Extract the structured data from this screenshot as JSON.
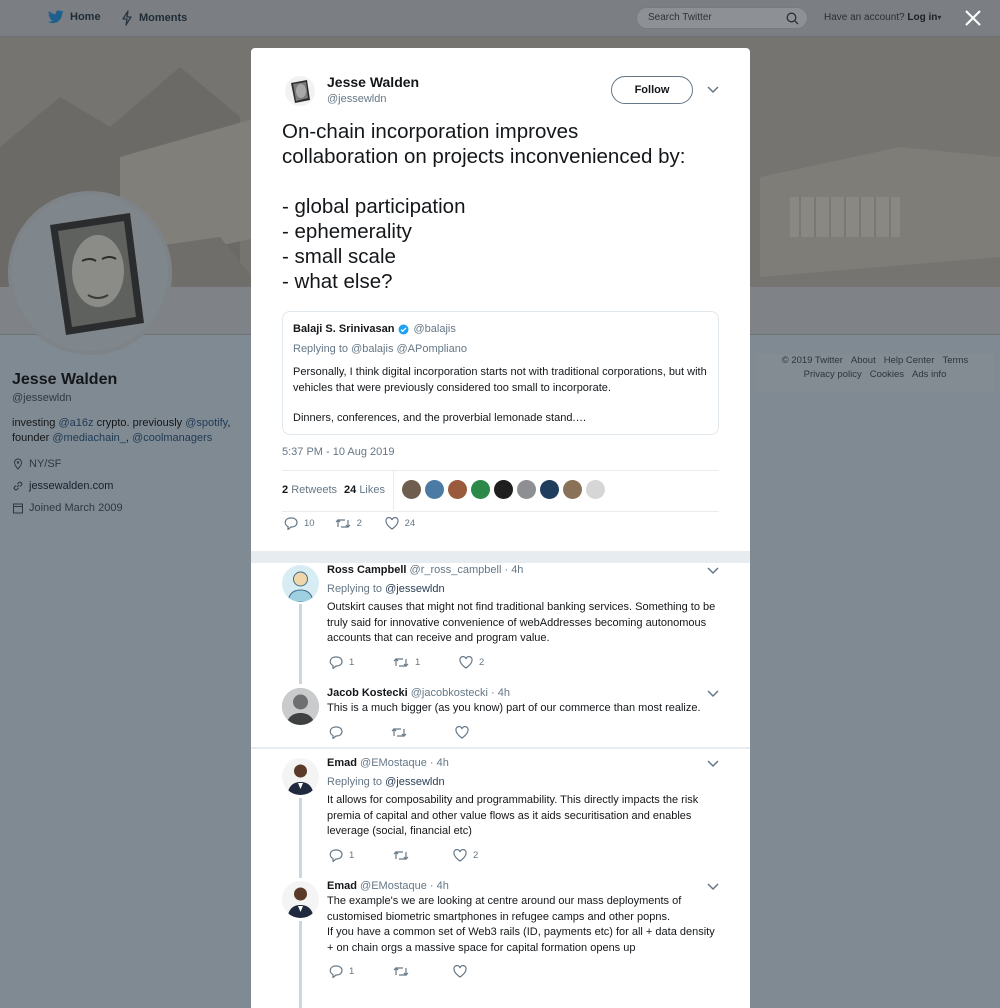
{
  "nav": {
    "home": "Home",
    "moments": "Moments",
    "search_placeholder": "Search Twitter",
    "have_account": "Have an account?",
    "login": "Log in"
  },
  "profile": {
    "name": "Jesse Walden",
    "handle": "@jessewldn",
    "bio_1": "investing ",
    "bio_a16z": "@a16z",
    "bio_2": " crypto. previously ",
    "bio_spotify": "@spotify",
    "bio_3": ", founder ",
    "bio_mediachain": "@mediachain_",
    "bio_4": ", ",
    "bio_coolmanagers": "@coolmanagers",
    "location": "NY/SF",
    "website": "jessewalden.com",
    "joined": "Joined March 2009"
  },
  "footer": [
    "© 2019 Twitter",
    "About",
    "Help Center",
    "Terms",
    "Privacy policy",
    "Cookies",
    "Ads info"
  ],
  "tweet": {
    "author_name": "Jesse Walden",
    "author_handle": "@jessewldn",
    "follow_label": "Follow",
    "lines": [
      "On-chain incorporation improves",
      "collaboration on projects inconvenienced by:",
      "",
      "- global participation",
      "- ephemerality",
      "- small scale",
      "- what else?"
    ],
    "quote": {
      "name": "Balaji S. Srinivasan",
      "handle": "@balajis",
      "replying_to": "Replying to @balajis @APompliano",
      "body_1": "Personally, I think digital incorporation starts not with traditional corporations, but with vehicles that were previously considered too small to incorporate.",
      "body_2": "Dinners, conferences, and the proverbial lemonade stand.…"
    },
    "timestamp": "5:37 PM - 10 Aug 2019",
    "retweets_count": "2",
    "retweets_label": "Retweets",
    "likes_count": "24",
    "likes_label": "Likes",
    "reply_count": "10",
    "retweet_count": "2",
    "like_count": "24"
  },
  "replies": [
    {
      "name": "Ross Campbell",
      "handle": "@r_ross_campbell",
      "time": "4h",
      "replying_label": "Replying to",
      "replying_to": "@jessewldn",
      "body": "Outskirt causes that might not find traditional banking services. Something to be truly said for innovative convenience of webAddresses becoming autonomous accounts that can receive and program value.",
      "replies": "1",
      "retweets": "1",
      "likes": "2"
    },
    {
      "name": "Jacob Kostecki",
      "handle": "@jacobkostecki",
      "time": "4h",
      "body": "This is a much bigger (as you know) part of our commerce than most realize.",
      "replies": "",
      "retweets": "",
      "likes": ""
    },
    {
      "name": "Emad",
      "handle": "@EMostaque",
      "time": "4h",
      "replying_label": "Replying to",
      "replying_to": "@jessewldn",
      "body": "It allows for composability and programmability. This directly impacts the risk premia of capital and other value flows as it aids securitisation and enables leverage (social, financial etc)",
      "replies": "1",
      "retweets": "",
      "likes": "2"
    },
    {
      "name": "Emad",
      "handle": "@EMostaque",
      "time": "4h",
      "body_1": "The example's we are looking at centre around our mass deployments of customised biometric smartphones in refugee camps and other popns.",
      "body_2": "If you have a common set of Web3 rails (ID, payments etc) for all + data density + on chain orgs a massive space for capital formation opens up",
      "replies": "1",
      "retweets": "",
      "likes": ""
    }
  ],
  "colors": {
    "accent": "#1da1f2",
    "overlay": "#808a92",
    "muted": "#657786"
  }
}
